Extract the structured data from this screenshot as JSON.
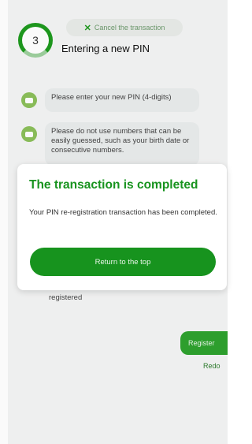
{
  "header": {
    "cancel_label": "Cancel the transaction",
    "step_number": "3",
    "step_title": "Entering a new PIN"
  },
  "chat": {
    "message_1": "Please enter your new PIN (4-digits)",
    "message_2": "Please do not use numbers that can be easily guessed, such as your birth date or consecutive numbers.",
    "partial_text": "registered",
    "register_label": "Register",
    "redo_label": "Redo"
  },
  "modal": {
    "title": "The transaction is completed",
    "message": "Your PIN re-registration transaction has been completed.",
    "button_label": "Return to the top"
  }
}
